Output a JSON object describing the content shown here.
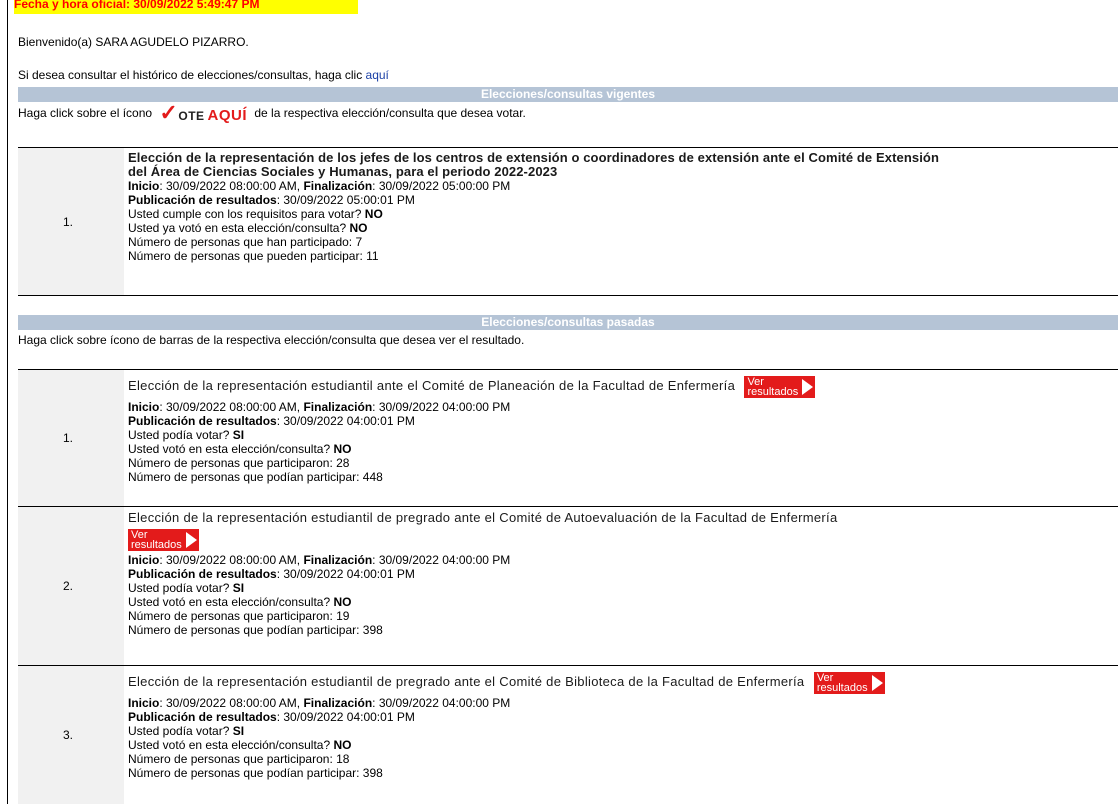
{
  "top_bar_text": "Fecha y hora oficial: 30/09/2022 5:49:47 PM",
  "welcome": {
    "prefix": "Bienvenido(a) ",
    "name": "SARA AGUDELO PIZARRO."
  },
  "history": {
    "text": "Si desea consultar el histórico de elecciones/consultas, haga clic ",
    "link": "aquí"
  },
  "current_section": {
    "header": "Elecciones/consultas vigentes",
    "instr_before": "Haga click sobre el ícono",
    "vote_icon": {
      "check": "✓",
      "ote": "OTE",
      "aqui": "AQUÍ"
    },
    "instr_after": "de la respectiva elección/consulta que desea votar.",
    "items": [
      {
        "number": "1.",
        "title_line1": "Elección de la representación de los jefes de los centros de extensión o coordinadores de extensión ante el Comité de Extensión",
        "title_line2": "del Área de Ciencias Sociales y Humanas, para el periodo 2022-2023",
        "inicio_label": "Inicio",
        "inicio": ": 30/09/2022 08:00:00 AM, ",
        "fin_label": "Finalización",
        "fin": ": 30/09/2022 05:00:00 PM",
        "pub_label": "Publicación de resultados",
        "pub": ": 30/09/2022 05:00:01 PM",
        "q1": "Usted cumple con los requisitos para votar? ",
        "a1": "NO",
        "q2": "Usted ya votó en esta elección/consulta? ",
        "a2": "NO",
        "participated": "Número de personas que han participado: 7",
        "eligible": "Número de personas que pueden participar: 11"
      }
    ]
  },
  "past_section": {
    "header": "Elecciones/consultas pasadas",
    "instr": "Haga click sobre ícono de barras de la respectiva elección/consulta que desea ver el resultado.",
    "ver_label1": "Ver",
    "ver_label2": "resultados",
    "items": [
      {
        "number": "1.",
        "title": "Elección de la representación estudiantil ante el Comité de Planeación de la Facultad de Enfermería",
        "inicio_label": "Inicio",
        "inicio": ": 30/09/2022 08:00:00 AM, ",
        "fin_label": "Finalización",
        "fin": ": 30/09/2022 04:00:00 PM",
        "pub_label": "Publicación de resultados",
        "pub": ": 30/09/2022 04:00:01 PM",
        "q1": "Usted podía votar? ",
        "a1": "SI",
        "q2": "Usted votó en esta elección/consulta? ",
        "a2": "NO",
        "participated": "Número de personas que participaron: 28",
        "eligible": "Número de personas que podían participar: 448"
      },
      {
        "number": "2.",
        "title": "Elección de la representación estudiantil de pregrado ante el Comité de Autoevaluación de la Facultad de Enfermería",
        "inicio_label": "Inicio",
        "inicio": ": 30/09/2022 08:00:00 AM, ",
        "fin_label": "Finalización",
        "fin": ": 30/09/2022 04:00:00 PM",
        "pub_label": "Publicación de resultados",
        "pub": ": 30/09/2022 04:00:01 PM",
        "q1": "Usted podía votar? ",
        "a1": "SI",
        "q2": "Usted votó en esta elección/consulta? ",
        "a2": "NO",
        "participated": "Número de personas que participaron: 19",
        "eligible": "Número de personas que podían participar: 398"
      },
      {
        "number": "3.",
        "title": "Elección de la representación estudiantil de pregrado ante el Comité de Biblioteca de la Facultad de Enfermería",
        "inicio_label": "Inicio",
        "inicio": ": 30/09/2022 08:00:00 AM, ",
        "fin_label": "Finalización",
        "fin": ": 30/09/2022 04:00:00 PM",
        "pub_label": "Publicación de resultados",
        "pub": ": 30/09/2022 04:00:01 PM",
        "q1": "Usted podía votar? ",
        "a1": "SI",
        "q2": "Usted votó en esta elección/consulta? ",
        "a2": "NO",
        "participated": "Número de personas que participaron: 18",
        "eligible": "Número de personas que podían participar: 398"
      }
    ]
  },
  "colors": {
    "header_bg": "#b5c4d6",
    "accent_red": "#e31b1b",
    "highlight": "#ffff00"
  }
}
